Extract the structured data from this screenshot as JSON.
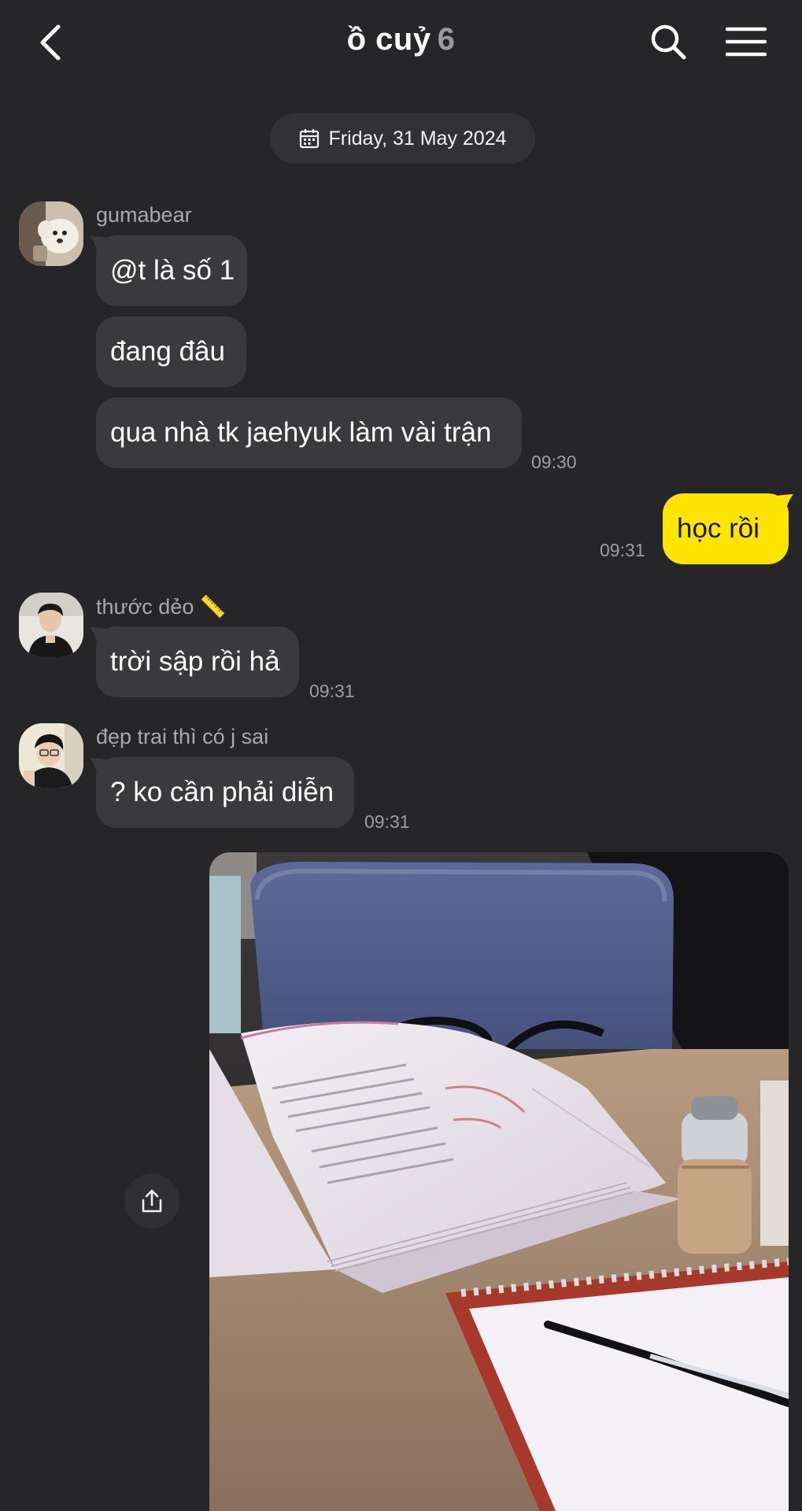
{
  "header": {
    "title": "ồ cuỷ",
    "member_count": "6",
    "icons": {
      "back": "chevron-left-icon",
      "search": "search-icon",
      "menu": "hamburger-menu-icon"
    }
  },
  "date_divider": {
    "icon": "calendar-icon",
    "text": "Friday, 31 May 2024"
  },
  "messages": [
    {
      "sender": "gumabear",
      "text": "@t là số 1"
    },
    {
      "sender": "gumabear",
      "text": "đang đâu"
    },
    {
      "sender": "gumabear",
      "text": "qua nhà tk jaehyuk làm vài trận",
      "time": "09:30"
    },
    {
      "sender": "me",
      "text": "học rồi",
      "time": "09:31"
    },
    {
      "sender": "thước dẻo",
      "sender_emoji": "📏",
      "text": "trời sập rồi hả",
      "time": "09:31"
    },
    {
      "sender": "đẹp trai thì có j sai",
      "text": "? ko cần phải diễn",
      "time": "09:31"
    },
    {
      "sender": "me",
      "type": "photo",
      "photo_description": "open book on wooden table with notebook and pen"
    }
  ],
  "share_button": {
    "icon": "share-icon"
  },
  "colors": {
    "background": "#262628",
    "incoming_bubble": "#3a3a3c",
    "outgoing_bubble": "#fee500",
    "secondary_text": "#9e9e9f"
  }
}
